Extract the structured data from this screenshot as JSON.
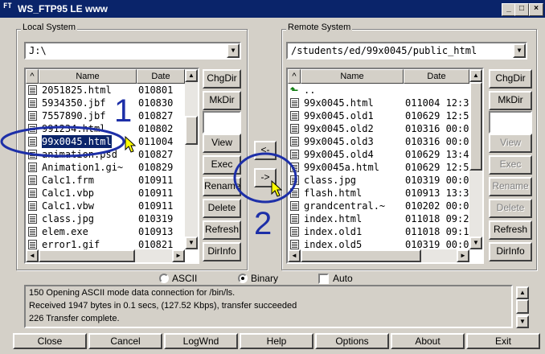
{
  "window": {
    "title": "WS_FTP95 LE www",
    "icon_text": "FT",
    "min_glyph": "_",
    "max_glyph": "□",
    "close_glyph": "×"
  },
  "local": {
    "group_label": "Local System",
    "path": "J:\\",
    "col_name": "Name",
    "col_date": "Date",
    "files": [
      {
        "name": "2051825.html",
        "date": "010801"
      },
      {
        "name": "5934350.jbf",
        "date": "010830"
      },
      {
        "name": "7557890.jbf",
        "date": "010827"
      },
      {
        "name": "991234.html",
        "date": "010802"
      },
      {
        "name": "99x0045.html",
        "date": "011004"
      },
      {
        "name": "animation.psd",
        "date": "010827"
      },
      {
        "name": "Animation1.gi~",
        "date": "010829"
      },
      {
        "name": "Calc1.frm",
        "date": "010911"
      },
      {
        "name": "Calc1.vbp",
        "date": "010911"
      },
      {
        "name": "Calc1.vbw",
        "date": "010911"
      },
      {
        "name": "class.jpg",
        "date": "010319"
      },
      {
        "name": "elem.exe",
        "date": "010913"
      },
      {
        "name": "error1.gif",
        "date": "010821"
      }
    ],
    "selected_index": 4,
    "buttons": [
      "ChgDir",
      "MkDir",
      "View",
      "Exec",
      "Rename",
      "Delete",
      "Refresh",
      "DirInfo"
    ]
  },
  "remote": {
    "group_label": "Remote System",
    "path": "/students/ed/99x0045/public_html",
    "col_name": "Name",
    "col_date": "Date",
    "files": [
      {
        "name": "..",
        "date": "",
        "type": "parent"
      },
      {
        "name": "99x0045.html",
        "date": "011004 12:3"
      },
      {
        "name": "99x0045.old1",
        "date": "010629 12:5"
      },
      {
        "name": "99x0045.old2",
        "date": "010316 00:0"
      },
      {
        "name": "99x0045.old3",
        "date": "010316 00:0"
      },
      {
        "name": "99x0045.old4",
        "date": "010629 13:4"
      },
      {
        "name": "99x0045a.html",
        "date": "010629 12:5"
      },
      {
        "name": "class.jpg",
        "date": "010319 00:0"
      },
      {
        "name": "flash.html",
        "date": "010913 13:3"
      },
      {
        "name": "grandcentral.~",
        "date": "010202 00:0"
      },
      {
        "name": "index.html",
        "date": "011018 09:2"
      },
      {
        "name": "index.old1",
        "date": "011018 09:1"
      },
      {
        "name": "index.old5",
        "date": "010319 00:0"
      }
    ],
    "buttons": [
      "ChgDir",
      "MkDir",
      "View",
      "Exec",
      "Rename",
      "Delete",
      "Refresh",
      "DirInfo"
    ],
    "disabled_buttons": [
      "View",
      "Exec",
      "Rename",
      "Delete"
    ]
  },
  "transfer": {
    "left_arrow": "<-",
    "right_arrow": "->"
  },
  "mode": {
    "ascii": "ASCII",
    "binary": "Binary",
    "auto": "Auto",
    "selected": "Binary",
    "auto_checked": false
  },
  "log": [
    "150 Opening ASCII mode data connection for /bin/ls.",
    "Received 1947 bytes in 0.1 secs, (127.52 Kbps), transfer succeeded",
    "226 Transfer complete."
  ],
  "bottom_buttons": [
    "Close",
    "Cancel",
    "LogWnd",
    "Help",
    "Options",
    "About",
    "Exit"
  ],
  "annotations": {
    "step1": "1",
    "step2": "2",
    "color": "#1d2fa8"
  },
  "colors": {
    "titlebar": "#0a246a",
    "selection": "#0a246a",
    "face": "#d4d0c8"
  }
}
